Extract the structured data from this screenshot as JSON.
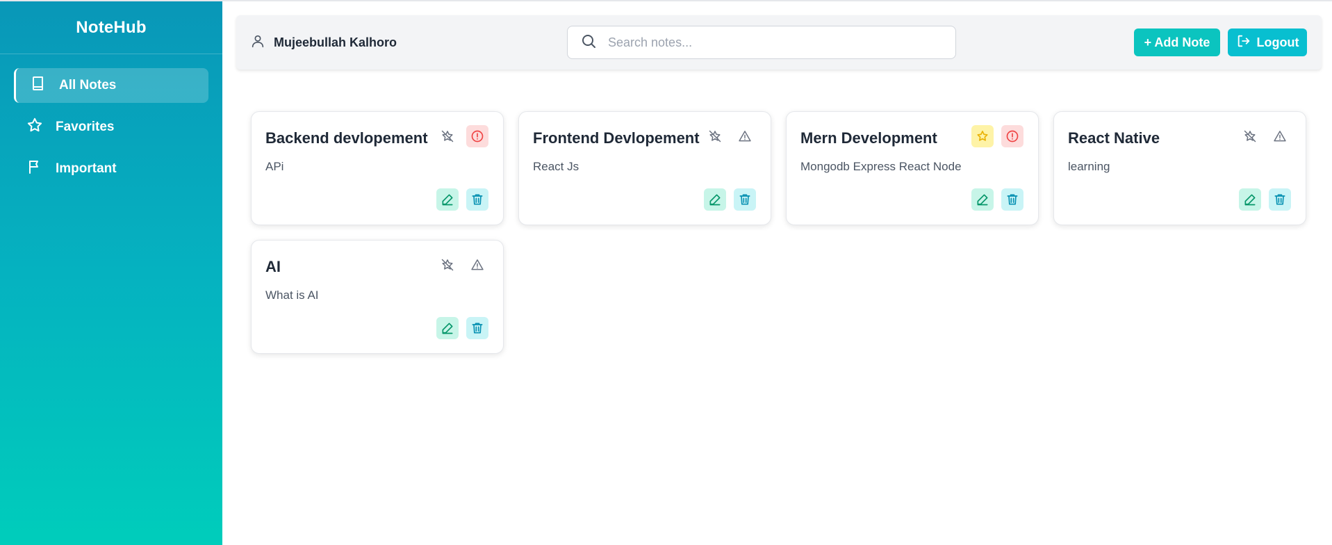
{
  "sidebar": {
    "brand": "NoteHub",
    "items": [
      {
        "label": "All Notes",
        "icon": "book-icon",
        "active": true
      },
      {
        "label": "Favorites",
        "icon": "star-icon",
        "active": false
      },
      {
        "label": "Important",
        "icon": "flag-icon",
        "active": false
      }
    ]
  },
  "header": {
    "user_name": "Mujeebullah Kalhoro",
    "search_placeholder": "Search notes...",
    "add_label": "+ Add Note",
    "logout_label": "Logout"
  },
  "notes": [
    {
      "title": "Backend devlopement",
      "desc": "APi",
      "favorite": false,
      "important": true
    },
    {
      "title": "Frontend Devlopement",
      "desc": "React Js",
      "favorite": false,
      "important": false
    },
    {
      "title": "Mern Development",
      "desc": "Mongodb Express React Node",
      "favorite": true,
      "important": true
    },
    {
      "title": "React Native",
      "desc": "learning",
      "favorite": false,
      "important": false
    },
    {
      "title": "AI",
      "desc": "What is AI",
      "favorite": false,
      "important": false
    }
  ],
  "colors": {
    "sidebar_top": "#0997b8",
    "sidebar_bottom": "#00cdbb",
    "accent": "#06c2c9",
    "favorite_on": "#eab308",
    "important_on": "#ef4444"
  }
}
